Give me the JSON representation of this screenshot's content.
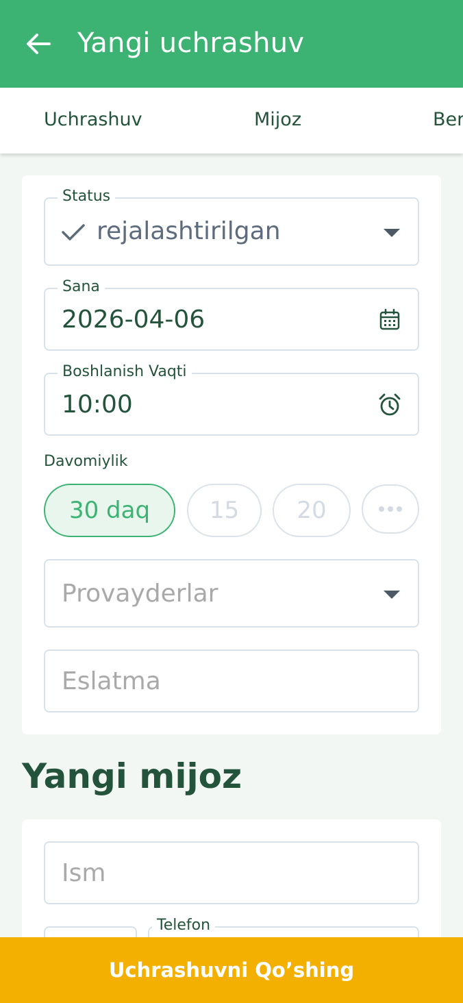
{
  "appbar": {
    "title": "Yangi uchrashuv",
    "back_icon": "arrow-left-icon"
  },
  "tabs": [
    {
      "label": "Uchrashuv"
    },
    {
      "label": "Mijoz"
    },
    {
      "label": "Ber"
    }
  ],
  "appointment": {
    "status": {
      "label": "Status",
      "value": "rejalashtirilgan",
      "icon": "check-icon"
    },
    "date": {
      "label": "Sana",
      "value": "2026-04-06",
      "icon": "calendar-icon"
    },
    "start_time": {
      "label": "Boshlanish Vaqti",
      "value": "10:00",
      "icon": "alarm-clock-icon"
    },
    "duration": {
      "label": "Davomiylik",
      "options": [
        {
          "label": "30 daq",
          "selected": true
        },
        {
          "label": "15",
          "selected": false
        },
        {
          "label": "20",
          "selected": false
        }
      ],
      "more_icon": "more-horizontal-icon"
    },
    "providers": {
      "placeholder": "Provayderlar"
    },
    "note": {
      "placeholder": "Eslatma"
    }
  },
  "new_client": {
    "title": "Yangi mijoz",
    "name": {
      "placeholder": "Ism"
    },
    "phone": {
      "label": "Telefon"
    }
  },
  "submit": {
    "label": "Uchrashuvni Qo’shing"
  },
  "colors": {
    "primary": "#3db373",
    "accent": "#f4b000",
    "text_dark": "#24533b",
    "background": "#f3f7f4"
  }
}
